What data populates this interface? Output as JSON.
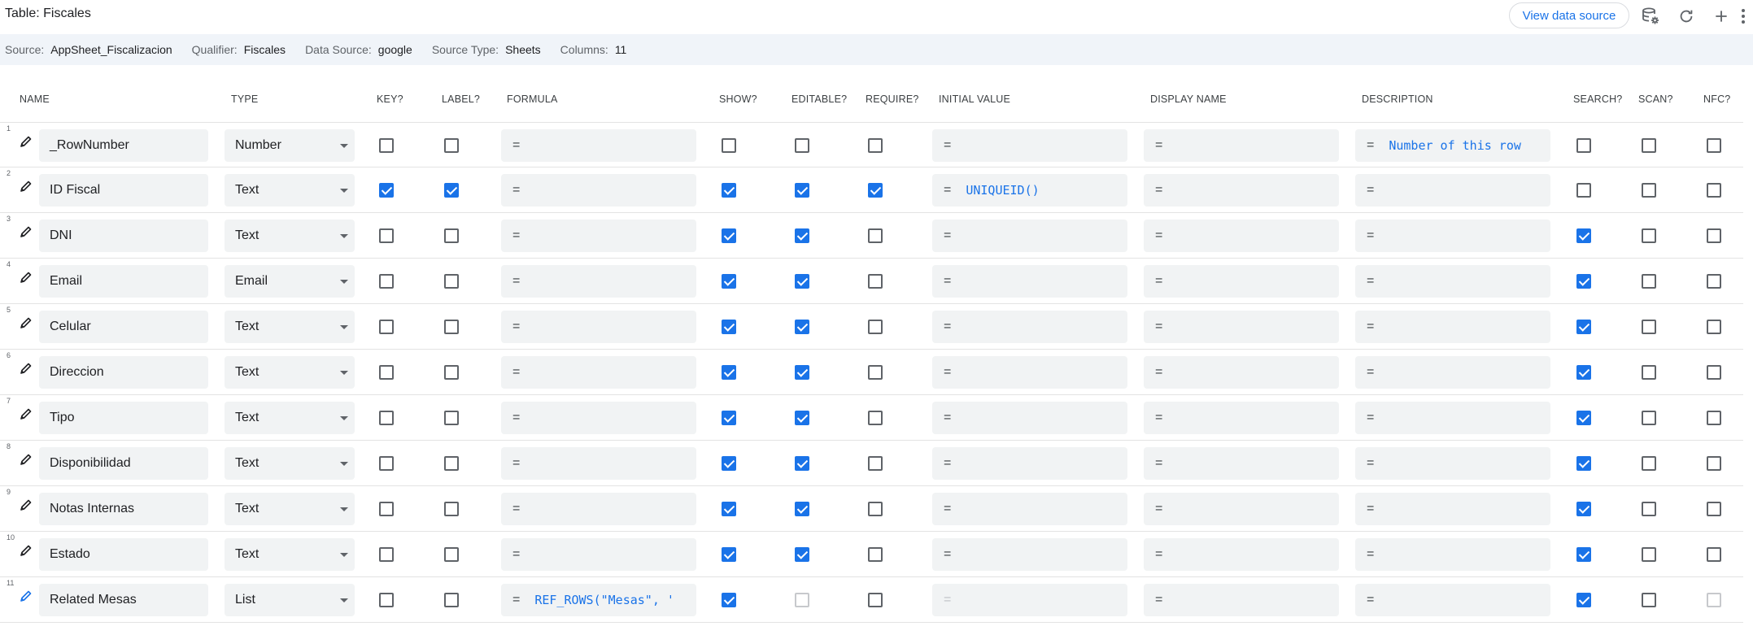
{
  "header": {
    "title": "Table: Fiscales",
    "view_button": "View data source",
    "icons": [
      "database-settings-icon",
      "refresh-icon",
      "add-icon",
      "more-vert-icon"
    ]
  },
  "info": {
    "source_label": "Source:",
    "source_value": "AppSheet_Fiscalizacion",
    "qualifier_label": "Qualifier:",
    "qualifier_value": "Fiscales",
    "datasource_label": "Data Source:",
    "datasource_value": "google",
    "sourcetype_label": "Source Type:",
    "sourcetype_value": "Sheets",
    "columns_label": "Columns:",
    "columns_value": "11"
  },
  "columns": {
    "name": "NAME",
    "type": "TYPE",
    "key": "KEY?",
    "label": "LABEL?",
    "formula": "FORMULA",
    "show": "SHOW?",
    "editable": "EDITABLE?",
    "require": "REQUIRE?",
    "initial": "INITIAL VALUE",
    "display": "DISPLAY NAME",
    "description": "DESCRIPTION",
    "search": "SEARCH?",
    "scan": "SCAN?",
    "nfc": "NFC?"
  },
  "eq_symbol": "=",
  "accent_color": "#1a73e8",
  "rows": [
    {
      "num": "1",
      "name": "_RowNumber",
      "type": "Number",
      "key": false,
      "label": false,
      "formula": "",
      "show": false,
      "editable": false,
      "require": false,
      "initial": "",
      "display": "",
      "description": "Number of this row",
      "search": false,
      "scan": false,
      "nfc": false
    },
    {
      "num": "2",
      "name": "ID Fiscal",
      "type": "Text",
      "key": true,
      "label": true,
      "formula": "",
      "show": true,
      "editable": true,
      "require": true,
      "initial": "UNIQUEID()",
      "display": "",
      "description": "",
      "search": false,
      "scan": false,
      "nfc": false
    },
    {
      "num": "3",
      "name": "DNI",
      "type": "Text",
      "key": false,
      "label": false,
      "formula": "",
      "show": true,
      "editable": true,
      "require": false,
      "initial": "",
      "display": "",
      "description": "",
      "search": true,
      "scan": false,
      "nfc": false
    },
    {
      "num": "4",
      "name": "Email",
      "type": "Email",
      "key": false,
      "label": false,
      "formula": "",
      "show": true,
      "editable": true,
      "require": false,
      "initial": "",
      "display": "",
      "description": "",
      "search": true,
      "scan": false,
      "nfc": false
    },
    {
      "num": "5",
      "name": "Celular",
      "type": "Text",
      "key": false,
      "label": false,
      "formula": "",
      "show": true,
      "editable": true,
      "require": false,
      "initial": "",
      "display": "",
      "description": "",
      "search": true,
      "scan": false,
      "nfc": false
    },
    {
      "num": "6",
      "name": "Direccion",
      "type": "Text",
      "key": false,
      "label": false,
      "formula": "",
      "show": true,
      "editable": true,
      "require": false,
      "initial": "",
      "display": "",
      "description": "",
      "search": true,
      "scan": false,
      "nfc": false
    },
    {
      "num": "7",
      "name": "Tipo",
      "type": "Text",
      "key": false,
      "label": false,
      "formula": "",
      "show": true,
      "editable": true,
      "require": false,
      "initial": "",
      "display": "",
      "description": "",
      "search": true,
      "scan": false,
      "nfc": false
    },
    {
      "num": "8",
      "name": "Disponibilidad",
      "type": "Text",
      "key": false,
      "label": false,
      "formula": "",
      "show": true,
      "editable": true,
      "require": false,
      "initial": "",
      "display": "",
      "description": "",
      "search": true,
      "scan": false,
      "nfc": false
    },
    {
      "num": "9",
      "name": "Notas Internas",
      "type": "Text",
      "key": false,
      "label": false,
      "formula": "",
      "show": true,
      "editable": true,
      "require": false,
      "initial": "",
      "display": "",
      "description": "",
      "search": true,
      "scan": false,
      "nfc": false
    },
    {
      "num": "10",
      "name": "Estado",
      "type": "Text",
      "key": false,
      "label": false,
      "formula": "",
      "show": true,
      "editable": true,
      "require": false,
      "initial": "",
      "display": "",
      "description": "",
      "search": true,
      "scan": false,
      "nfc": false
    },
    {
      "num": "11",
      "name": "Related Mesas",
      "type": "List",
      "key": false,
      "label": false,
      "formula": "REF_ROWS(\"Mesas\", '",
      "show": true,
      "editable": false,
      "editable_disabled": true,
      "require": false,
      "initial": "",
      "initial_disabled": true,
      "display": "",
      "description": "",
      "search": true,
      "scan": false,
      "nfc": false,
      "nfc_disabled": true,
      "pencil_color": "#1a73e8"
    }
  ]
}
